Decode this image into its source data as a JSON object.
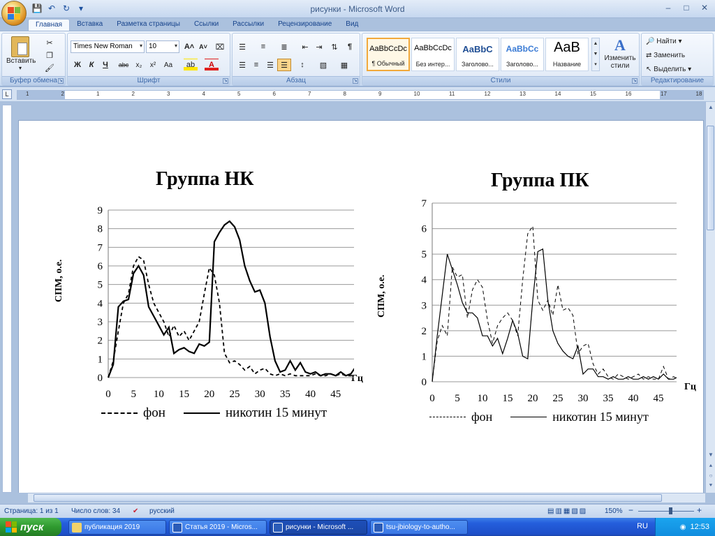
{
  "window": {
    "title": "рисунки - Microsoft Word",
    "qat": [
      "save-icon",
      "undo-icon",
      "redo-icon",
      "customize-icon"
    ]
  },
  "tabs": [
    "Главная",
    "Вставка",
    "Разметка страницы",
    "Ссылки",
    "Рассылки",
    "Рецензирование",
    "Вид"
  ],
  "ribbon": {
    "clipboard": {
      "label": "Буфер обмена",
      "paste": "Вставить"
    },
    "font": {
      "label": "Шрифт",
      "family": "Times New Roman",
      "size": "10"
    },
    "paragraph": {
      "label": "Абзац"
    },
    "styles": {
      "label": "Стили",
      "items": [
        {
          "sample": "AaBbCcDc",
          "name": "¶ Обычный"
        },
        {
          "sample": "AaBbCcDc",
          "name": "Без интер..."
        },
        {
          "sample": "AaBbC",
          "name": "Заголово..."
        },
        {
          "sample": "AaBbCc",
          "name": "Заголово..."
        },
        {
          "sample": "AaB",
          "name": "Название"
        }
      ],
      "change": "Изменить стили"
    },
    "editing": {
      "label": "Редактирование",
      "find": "Найти",
      "replace": "Заменить",
      "select": "Выделить"
    }
  },
  "ruler": {
    "numbers": [
      "1",
      "2",
      "1",
      "2",
      "3",
      "4",
      "5",
      "6",
      "7",
      "8",
      "9",
      "10",
      "11",
      "12",
      "13",
      "14",
      "15",
      "16",
      "17",
      "18"
    ]
  },
  "document": {
    "chart_data": [
      {
        "type": "line",
        "title": "Группа НК",
        "ylabel": "СПМ, о.е.",
        "xunit": "Гц",
        "xlim": [
          0,
          50
        ],
        "ylim": [
          0,
          9
        ],
        "xticks": [
          "0",
          "5",
          "10",
          "15",
          "20",
          "25",
          "30",
          "35",
          "40",
          "45",
          "50"
        ],
        "yticks": [
          "0",
          "1",
          "2",
          "3",
          "4",
          "5",
          "6",
          "7",
          "8",
          "9"
        ],
        "grid": true,
        "series": [
          {
            "name": "фон",
            "style": "dashed",
            "x": [
              0,
              1,
              2,
              3,
              4,
              5,
              6,
              7,
              8,
              9,
              10,
              11,
              12,
              13,
              14,
              15,
              16,
              17,
              18,
              19,
              20,
              21,
              22,
              23,
              24,
              25,
              26,
              27,
              28,
              29,
              30,
              31,
              32,
              33,
              34,
              35,
              36,
              37,
              38,
              39,
              40,
              41,
              42,
              43,
              44,
              45,
              46,
              47,
              48,
              49,
              50
            ],
            "y": [
              0,
              0.9,
              2.5,
              4,
              4.5,
              6,
              6.5,
              6.3,
              5,
              4,
              3.5,
              3,
              2.2,
              2.8,
              2.2,
              2.5,
              2,
              2.5,
              3,
              4.5,
              5.9,
              5.5,
              4,
              1.3,
              0.8,
              0.9,
              0.7,
              0.4,
              0.6,
              0.2,
              0.4,
              0.5,
              0.2,
              0.1,
              0.2,
              0.1,
              0.2,
              0.1,
              0.1,
              0.1,
              0.1,
              0.2,
              0.1,
              0.1,
              0.2,
              0.1,
              0.2,
              0.1,
              0.1,
              0.1,
              0.1
            ]
          },
          {
            "name": "никотин 15 минут",
            "style": "solid",
            "x": [
              0,
              1,
              2,
              3,
              4,
              5,
              6,
              7,
              8,
              9,
              10,
              11,
              12,
              13,
              14,
              15,
              16,
              17,
              18,
              19,
              20,
              21,
              22,
              23,
              24,
              25,
              26,
              27,
              28,
              29,
              30,
              31,
              32,
              33,
              34,
              35,
              36,
              37,
              38,
              39,
              40,
              41,
              42,
              43,
              44,
              45,
              46,
              47,
              48,
              49,
              50
            ],
            "y": [
              0,
              0.7,
              3.8,
              4.1,
              4.2,
              5.6,
              6,
              5.5,
              3.8,
              3.3,
              2.8,
              2.3,
              2.7,
              1.3,
              1.5,
              1.6,
              1.4,
              1.3,
              1.8,
              1.7,
              1.9,
              7.3,
              7.8,
              8.2,
              8.4,
              8.1,
              7.4,
              6,
              5.2,
              4.6,
              4.7,
              4,
              2.2,
              0.9,
              0.3,
              0.4,
              0.9,
              0.4,
              0.8,
              0.3,
              0.2,
              0.3,
              0.1,
              0.2,
              0.2,
              0.1,
              0.3,
              0.1,
              0.2,
              0.6,
              0.1
            ]
          }
        ],
        "legend": [
          "фон",
          "никотин 15 минут"
        ]
      },
      {
        "type": "line",
        "title": "Группа ПК",
        "ylabel": "СПМ, о.е.",
        "xunit": "Гц",
        "xlim": [
          0,
          50
        ],
        "ylim": [
          0,
          7
        ],
        "xticks": [
          "0",
          "5",
          "10",
          "15",
          "20",
          "25",
          "30",
          "35",
          "40",
          "45",
          "50"
        ],
        "yticks": [
          "0",
          "1",
          "2",
          "3",
          "4",
          "5",
          "6",
          "7"
        ],
        "grid": true,
        "series": [
          {
            "name": "фон",
            "style": "dashed",
            "x": [
              0,
              1,
              2,
              3,
              4,
              5,
              6,
              7,
              8,
              9,
              10,
              11,
              12,
              13,
              14,
              15,
              16,
              17,
              18,
              19,
              20,
              21,
              22,
              23,
              24,
              25,
              26,
              27,
              28,
              29,
              30,
              31,
              32,
              33,
              34,
              35,
              36,
              37,
              38,
              39,
              40,
              41,
              42,
              43,
              44,
              45,
              46,
              47,
              48,
              49,
              50
            ],
            "y": [
              0,
              1.6,
              2.2,
              1.8,
              4.5,
              4.1,
              4.2,
              2.5,
              3.6,
              4.0,
              3.7,
              2.4,
              1.5,
              2.2,
              2.5,
              2.7,
              2.4,
              1.8,
              4,
              5.8,
              6.1,
              3.2,
              2.8,
              3.2,
              2.6,
              3.8,
              2.8,
              2.9,
              2.6,
              1.1,
              1.4,
              1.5,
              0.7,
              0.3,
              0.5,
              0.2,
              0.1,
              0.3,
              0.2,
              0.1,
              0.2,
              0.3,
              0.1,
              0.2,
              0.1,
              0.1,
              0.6,
              0.1,
              0.2,
              0.1,
              0.3
            ]
          },
          {
            "name": "никотин 15 минут",
            "style": "solid",
            "x": [
              0,
              1,
              2,
              3,
              4,
              5,
              6,
              7,
              8,
              9,
              10,
              11,
              12,
              13,
              14,
              15,
              16,
              17,
              18,
              19,
              20,
              21,
              22,
              23,
              24,
              25,
              26,
              27,
              28,
              29,
              30,
              31,
              32,
              33,
              34,
              35,
              36,
              37,
              38,
              39,
              40,
              41,
              42,
              43,
              44,
              45,
              46,
              47,
              48,
              49,
              50
            ],
            "y": [
              0,
              1.8,
              3.4,
              5,
              4.4,
              3.8,
              3.1,
              2.7,
              2.7,
              2.5,
              1.8,
              1.8,
              1.4,
              1.7,
              1.1,
              1.7,
              2.4,
              1.9,
              1.0,
              0.9,
              3.2,
              5.1,
              5.2,
              3.2,
              2.0,
              1.5,
              1.2,
              1.0,
              0.9,
              1.4,
              0.3,
              0.5,
              0.5,
              0.2,
              0.2,
              0.1,
              0.2,
              0.1,
              0.1,
              0.2,
              0.1,
              0.1,
              0.2,
              0.1,
              0.2,
              0.1,
              0.3,
              0.1,
              0.1,
              0.2,
              0.2
            ]
          }
        ],
        "legend": [
          "фон",
          "никотин 15 минут"
        ]
      }
    ]
  },
  "status": {
    "page": "Страница: 1 из 1",
    "words": "Число слов: 34",
    "lang": "русский",
    "zoom": "150%"
  },
  "taskbar": {
    "start": "пуск",
    "items": [
      "публикация 2019",
      "Статья 2019 - Micros...",
      "рисунки - Microsoft ...",
      "tsu-jbiology-to-autho..."
    ],
    "lang": "RU",
    "time": "12:53"
  }
}
